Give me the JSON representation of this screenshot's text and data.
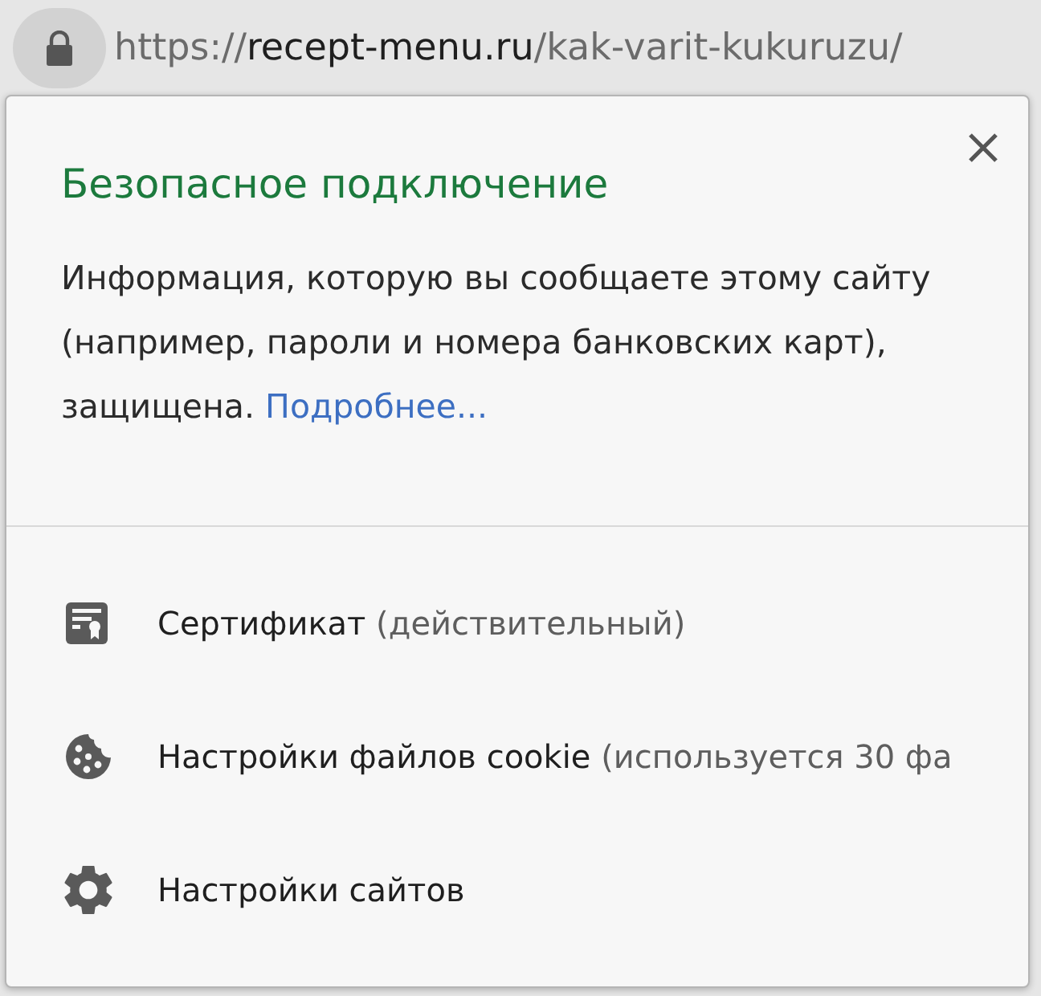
{
  "address_bar": {
    "scheme": "https://",
    "host": "recept-menu.ru",
    "path": "/kak-varit-kukuruzu/"
  },
  "popup": {
    "title": "Безопасное подключение",
    "description": "Информация, которую вы сообщаете этому сайту (например, пароли и номера банковских карт), защищена.",
    "link": "Подробнее..."
  },
  "items": [
    {
      "kind": "certificate",
      "label": "Сертификат",
      "detail": "(действительный)"
    },
    {
      "kind": "cookies",
      "label": "Настройки файлов cookie",
      "detail": "(используется 30 фа"
    },
    {
      "kind": "settings",
      "label": "Настройки сайтов"
    }
  ]
}
